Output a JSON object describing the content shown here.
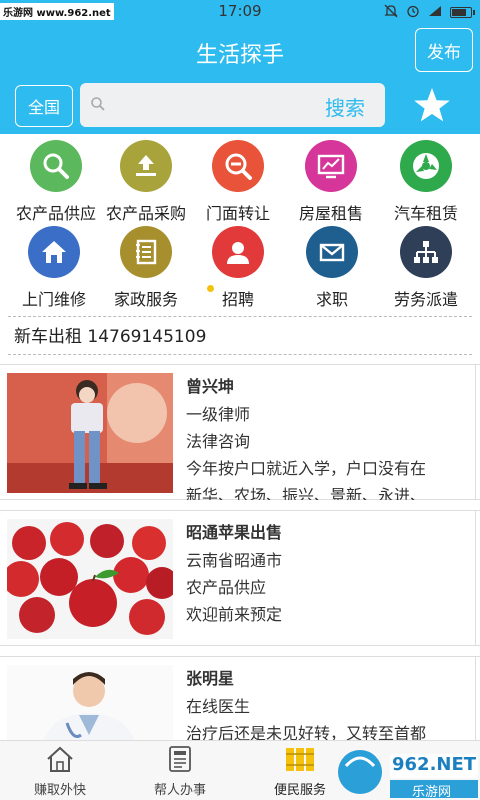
{
  "status_bar": {
    "watermark": "乐游网 www.962.net",
    "time": "17:09"
  },
  "header": {
    "title": "生活探手",
    "publish_label": "发布"
  },
  "search": {
    "region_label": "全国",
    "placeholder": "",
    "button_label": "搜索"
  },
  "categories": [
    {
      "label": "农产品供应",
      "color": "#5cb85c",
      "icon": "search-icon"
    },
    {
      "label": "农产品采购",
      "color": "#a8a33a",
      "icon": "upload-icon"
    },
    {
      "label": "门面转让",
      "color": "#e8533a",
      "icon": "zoom-out-icon"
    },
    {
      "label": "房屋租售",
      "color": "#d6369a",
      "icon": "chart-monitor-icon"
    },
    {
      "label": "汽车租赁",
      "color": "#2eaa4c",
      "icon": "wheel-icon"
    },
    {
      "label": "上门维修",
      "color": "#3b6fc7",
      "icon": "home-icon"
    },
    {
      "label": "家政服务",
      "color": "#a88f2e",
      "icon": "notebook-icon"
    },
    {
      "label": "招聘",
      "color": "#e23a3a",
      "icon": "person-icon"
    },
    {
      "label": "求职",
      "color": "#1f5f8f",
      "icon": "mail-icon"
    },
    {
      "label": "劳务派遣",
      "color": "#2f3f57",
      "icon": "org-chart-icon"
    }
  ],
  "ticker": "新车出租 14769145109",
  "listings": [
    {
      "name": "曾兴坤",
      "line1": "一级律师",
      "line2": "法律咨询",
      "line3": "今年按户口就近入学，户口没有在",
      "line4": "新华、农场、振兴、景新、永进、"
    },
    {
      "name": "昭通苹果出售",
      "line1": "云南省昭通市",
      "line2": "农产品供应",
      "line3": "欢迎前来预定",
      "line4": ""
    },
    {
      "name": "张明星",
      "line1": "在线医生",
      "line2": "治疗后还是未见好转，又转至首都",
      "line3": "",
      "line4": ""
    }
  ],
  "bottom_nav": [
    {
      "label": "赚取外快",
      "icon": "house-outline-icon"
    },
    {
      "label": "帮人办事",
      "icon": "news-doc-icon"
    },
    {
      "label": "便民服务",
      "icon": "books-icon"
    }
  ],
  "brand": {
    "logo_text": "962.NET",
    "logo_sub": "乐游网"
  },
  "colors": {
    "primary": "#2ebbef",
    "accent_yellow": "#f4c20d"
  }
}
